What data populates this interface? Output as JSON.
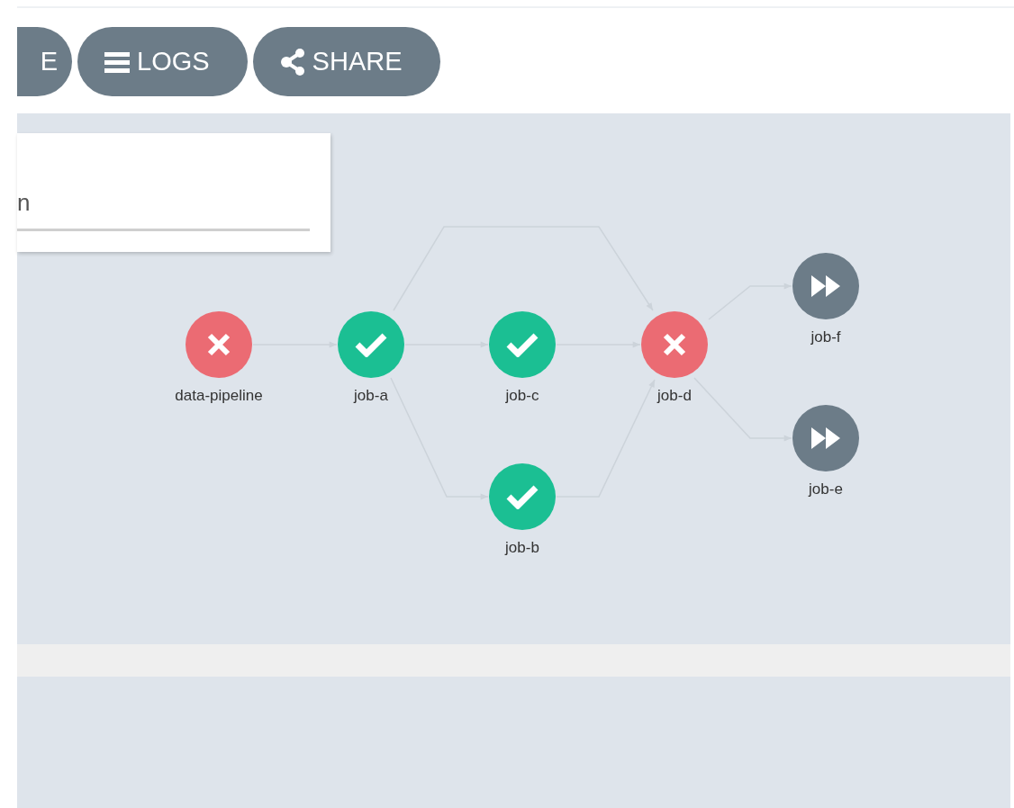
{
  "toolbar": {
    "buttons": [
      {
        "label": "E",
        "kind": "cut"
      },
      {
        "label": "LOGS",
        "kind": "logs"
      },
      {
        "label": "SHARE",
        "kind": "share"
      }
    ]
  },
  "panel": {
    "field_value": "n"
  },
  "graph": {
    "nodes": [
      {
        "label": "data-pipeline",
        "kind": "failed"
      },
      {
        "label": "job-a",
        "kind": "succeeded"
      },
      {
        "label": "job-c",
        "kind": "succeeded"
      },
      {
        "label": "job-d",
        "kind": "failed"
      },
      {
        "label": "job-b",
        "kind": "succeeded"
      },
      {
        "label": "job-f",
        "kind": "skipped"
      },
      {
        "label": "job-e",
        "kind": "skipped"
      }
    ]
  }
}
